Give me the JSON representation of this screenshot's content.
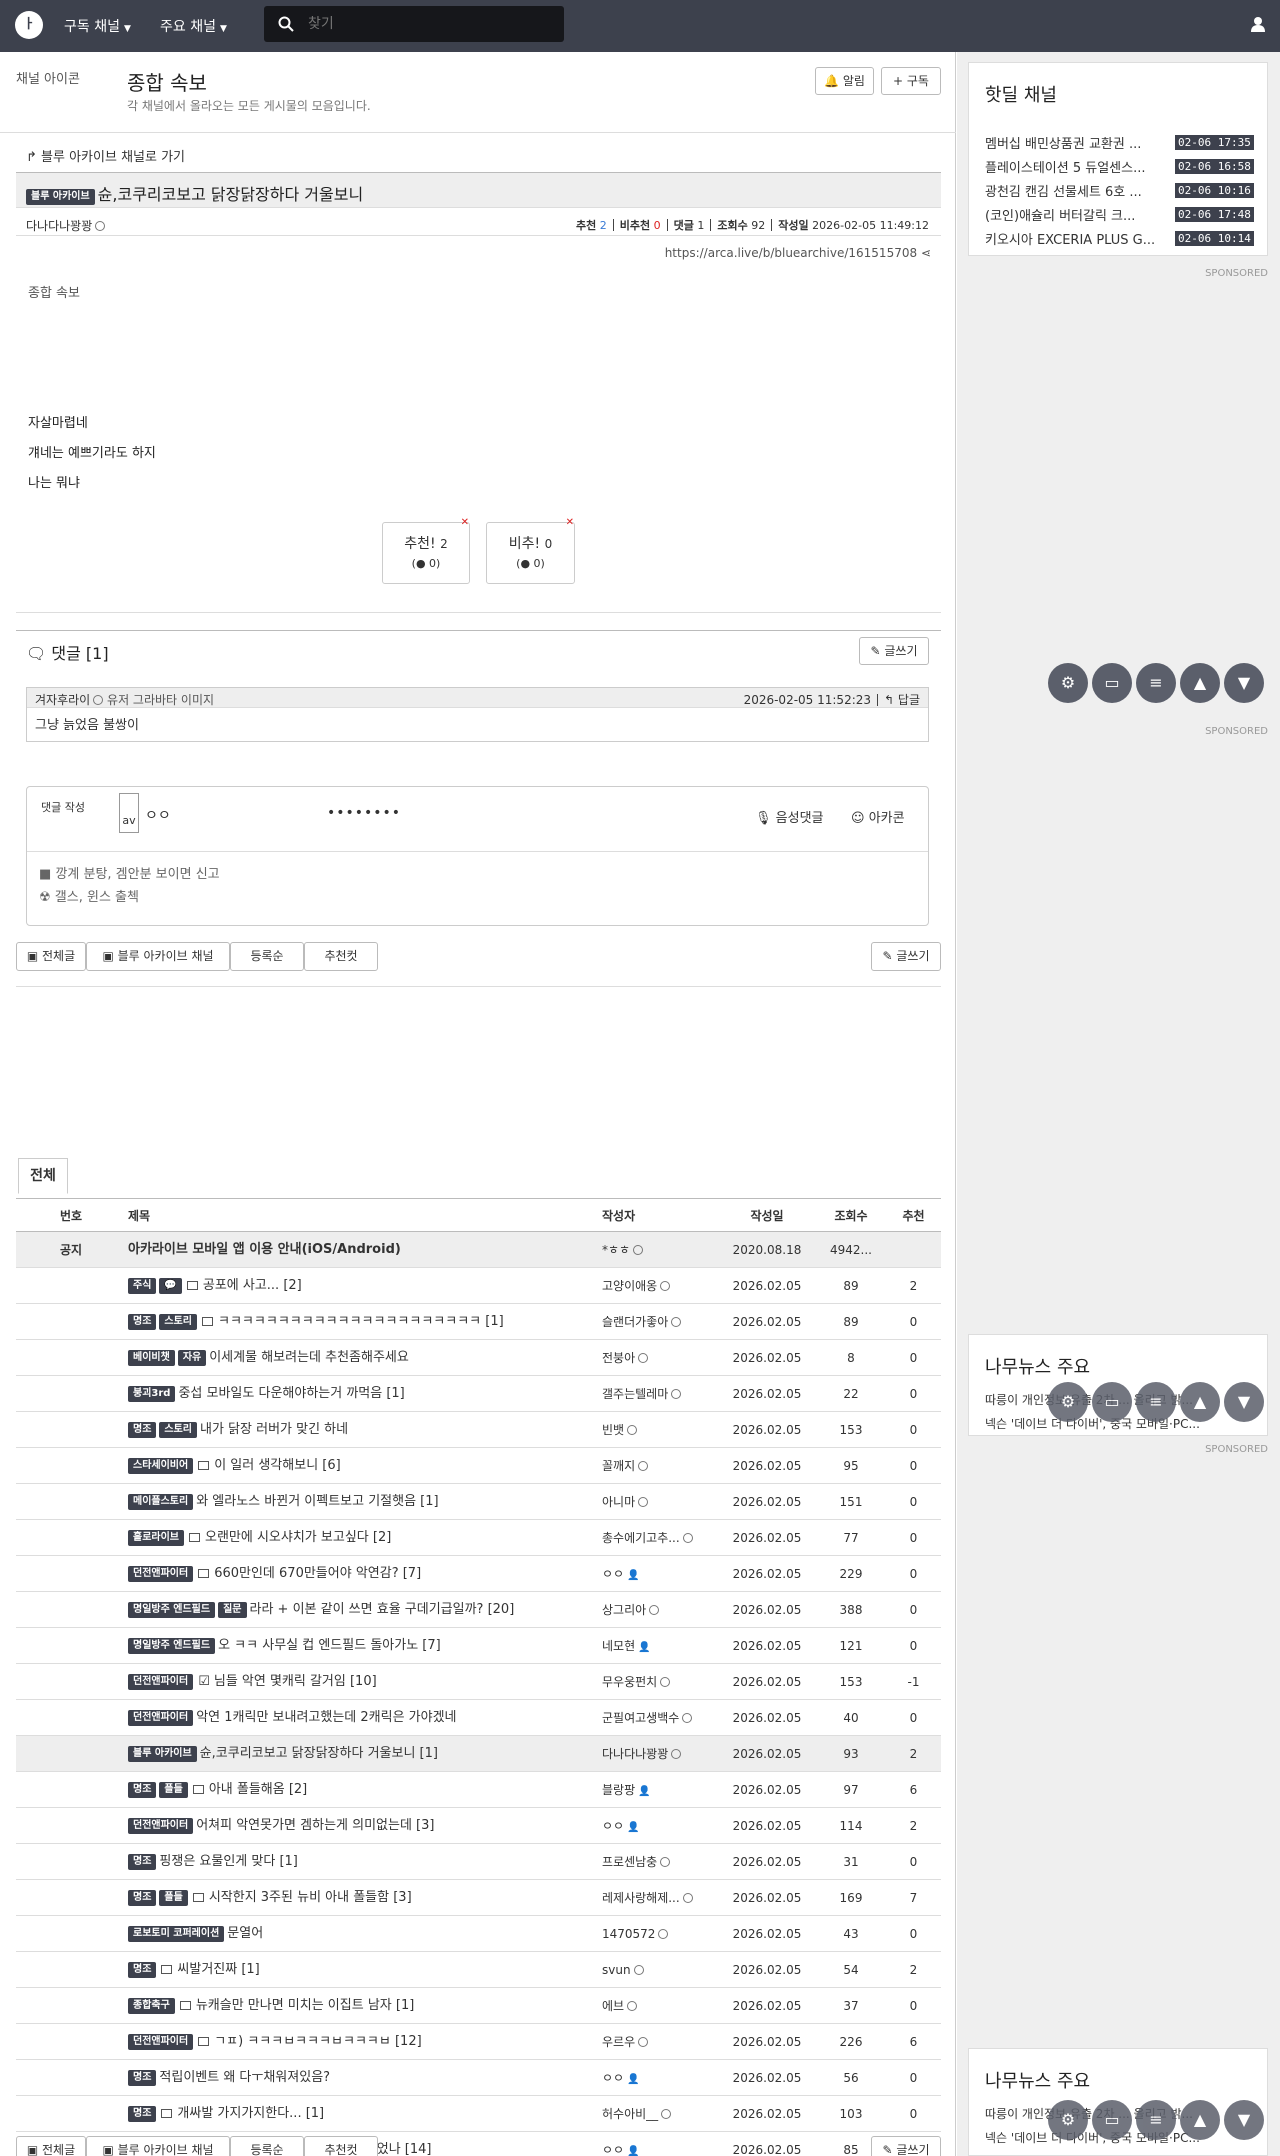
{
  "topbar": {
    "logo": "arca-logo-icon",
    "nav_subscribed": "구독 채널",
    "nav_major": "주요 채널",
    "search_placeholder": "찾기"
  },
  "channel": {
    "icon_alt": "채널 아이콘",
    "title": "종합 속보",
    "description": "각 채널에서 올라오는 모든 게시물의 모음입니다.",
    "alert_btn": "알림",
    "subscribe_btn": "구독"
  },
  "post": {
    "back_link": "블루 아카이브 채널로 가기",
    "category": "블루 아카이브",
    "title": "슌,코쿠리코보고 닭장닭장하다 거울보니",
    "author": "다나다나꽝꽝",
    "rec_label": "추천",
    "rec": "2",
    "unrec_label": "비추천",
    "unrec": "0",
    "comments_label": "댓글",
    "comments": "1",
    "views_label": "조회수",
    "views": "92",
    "date_label": "작성일",
    "date": "2026-02-05 11:49:12",
    "url": "https://arca.live/b/bluearchive/161515708",
    "image_alt": "종합 속보",
    "body_lines": [
      "자살마렵네",
      "걔네는 예쁘기라도 하지",
      "나는 뭐냐"
    ],
    "vote_up": "추천!",
    "vote_up_count": "2",
    "vote_up_sub": "0",
    "vote_down": "비추!",
    "vote_down_count": "0",
    "vote_down_sub": "0"
  },
  "comments": {
    "header": "댓글 [1]",
    "write_btn": "글쓰기",
    "items": [
      {
        "author": "겨자후라이",
        "avatar_alt": "유저 그라바타 이미지",
        "date": "2026-02-05 11:52:23",
        "reply": "답글",
        "text": "그냥 늙었음 불쌍이"
      }
    ],
    "form_label": "댓글 작성",
    "form_avatar": "av",
    "form_name": "ㅇㅇ",
    "form_password": "••••••••",
    "voice": "음성댓글",
    "arcacon": "아카콘",
    "notice_lines": [
      "깡계 분탕, 겜안분 보이면 신고",
      "갤스, 윈스 출첵"
    ]
  },
  "filterbar": {
    "all": "전체글",
    "channel": "블루 아카이브 채널",
    "order": "등록순",
    "best": "추천컷",
    "write": "글쓰기"
  },
  "table": {
    "tab": "전체",
    "headers": {
      "num": "번호",
      "title": "제목",
      "author": "작성자",
      "date": "작성일",
      "views": "조회수",
      "rec": "추천"
    },
    "notice": {
      "num": "공지",
      "title": "아카라이브 모바일 앱 이용 안내(iOS/Android)",
      "author": "*ㅎㅎ",
      "date": "2020.08.18",
      "views": "4942...",
      "rec": ""
    },
    "rows": [
      {
        "badges": [
          "주식",
          "💬"
        ],
        "icon": true,
        "check": false,
        "title": "공포에 사고... [2]",
        "author": "고양이애옹",
        "date": "2026.02.05",
        "views": "89",
        "rec": "2"
      },
      {
        "badges": [
          "명조",
          "스토리"
        ],
        "icon": true,
        "check": false,
        "title": "ㅋㅋㅋㅋㅋㅋㅋㅋㅋㅋㅋㅋㅋㅋㅋㅋㅋㅋㅋㅋㅋㅋ [1]",
        "author": "슬랜더가좋아",
        "date": "2026.02.05",
        "views": "89",
        "rec": "0"
      },
      {
        "badges": [
          "베이비챗",
          "자유"
        ],
        "icon": false,
        "check": false,
        "title": "이세계물 해보려는데 추천좀해주세요",
        "author": "전붕아",
        "date": "2026.02.05",
        "views": "8",
        "rec": "0"
      },
      {
        "badges": [
          "붕괴3rd"
        ],
        "icon": false,
        "check": false,
        "title": "중섭 모바일도 다운해야하는거 까먹음 [1]",
        "author": "갤주는텔레마",
        "date": "2026.02.05",
        "views": "22",
        "rec": "0"
      },
      {
        "badges": [
          "명조",
          "스토리"
        ],
        "icon": false,
        "check": false,
        "title": "내가 닭장 러버가 맞긴 하네",
        "author": "빈뱃",
        "date": "2026.02.05",
        "views": "153",
        "rec": "0"
      },
      {
        "badges": [
          "스타세이비어"
        ],
        "icon": true,
        "check": false,
        "title": "이 일러 생각해보니 [6]",
        "author": "꼴깨지",
        "date": "2026.02.05",
        "views": "95",
        "rec": "0"
      },
      {
        "badges": [
          "메이플스토리"
        ],
        "icon": false,
        "check": false,
        "title": "와 엘라노스 바뀐거 이펙트보고 기절햇음 [1]",
        "author": "아니마",
        "date": "2026.02.05",
        "views": "151",
        "rec": "0"
      },
      {
        "badges": [
          "홀로라이브"
        ],
        "icon": true,
        "check": false,
        "title": "오랜만에 시오샤치가 보고싶다 [2]",
        "author": "총수에기고추...",
        "date": "2026.02.05",
        "views": "77",
        "rec": "0"
      },
      {
        "badges": [
          "던전앤파이터"
        ],
        "icon": true,
        "check": false,
        "title": "660만인데 670만들어야 악연감? [7]",
        "author": "ㅇㅇ",
        "date": "2026.02.05",
        "views": "229",
        "rec": "0"
      },
      {
        "badges": [
          "명일방주 엔드필드",
          "질문"
        ],
        "icon": false,
        "check": false,
        "title": "라라 + 이본 같이 쓰면 효율 구데기급일까? [20]",
        "author": "상그리아",
        "date": "2026.02.05",
        "views": "388",
        "rec": "0"
      },
      {
        "badges": [
          "명일방주 엔드필드"
        ],
        "icon": false,
        "check": false,
        "title": "오 ㅋㅋ 사무실 컵 엔드필드 돌아가노 [7]",
        "author": "네모현",
        "date": "2026.02.05",
        "views": "121",
        "rec": "0"
      },
      {
        "badges": [
          "던전앤파이터"
        ],
        "icon": false,
        "check": true,
        "title": "님들 악연 몇캐릭 갈거임 [10]",
        "author": "무우웅펀치",
        "date": "2026.02.05",
        "views": "153",
        "rec": "-1"
      },
      {
        "badges": [
          "던전앤파이터"
        ],
        "icon": false,
        "check": false,
        "title": "악연 1캐릭만 보내려고했는데 2캐릭은 가야겠네",
        "author": "군필여고생백수",
        "date": "2026.02.05",
        "views": "40",
        "rec": "0"
      },
      {
        "badges": [
          "블루 아카이브"
        ],
        "icon": false,
        "check": false,
        "title": "슌,코쿠리코보고 닭장닭장하다 거울보니 [1]",
        "author": "다나다나꽝꽝",
        "date": "2026.02.05",
        "views": "93",
        "rec": "2",
        "hl": true
      },
      {
        "badges": [
          "명조",
          "플들"
        ],
        "icon": true,
        "check": false,
        "title": "아내 폴들해옴 [2]",
        "author": "블랑팡",
        "date": "2026.02.05",
        "views": "97",
        "rec": "6"
      },
      {
        "badges": [
          "던전앤파이터"
        ],
        "icon": false,
        "check": false,
        "title": "어쳐피 악연못가면 겜하는게 의미없는데 [3]",
        "author": "ㅇㅇ",
        "date": "2026.02.05",
        "views": "114",
        "rec": "2"
      },
      {
        "badges": [
          "명조"
        ],
        "icon": false,
        "check": false,
        "title": "핑쟁은 요물인게 맞다 [1]",
        "author": "프로센남충",
        "date": "2026.02.05",
        "views": "31",
        "rec": "0"
      },
      {
        "badges": [
          "명조",
          "플들"
        ],
        "icon": true,
        "check": false,
        "title": "시작한지 3주된 뉴비 아내 폴들함 [3]",
        "author": "레제사랑해제...",
        "date": "2026.02.05",
        "views": "169",
        "rec": "7"
      },
      {
        "badges": [
          "로보토미 코퍼레이션"
        ],
        "icon": false,
        "check": false,
        "title": "문열어",
        "author": "1470572",
        "date": "2026.02.05",
        "views": "43",
        "rec": "0"
      },
      {
        "badges": [
          "명조"
        ],
        "icon": true,
        "check": false,
        "title": "씨발거진짜 [1]",
        "author": "svun",
        "date": "2026.02.05",
        "views": "54",
        "rec": "2"
      },
      {
        "badges": [
          "종합축구"
        ],
        "icon": true,
        "check": false,
        "title": "뉴캐슬만 만나면 미치는 이집트 남자 [1]",
        "author": "에브",
        "date": "2026.02.05",
        "views": "37",
        "rec": "0"
      },
      {
        "badges": [
          "던전앤파이터"
        ],
        "icon": true,
        "check": false,
        "title": "ㄱㅍ) ㅋㅋㅋㅂㅋㅋㅋㅂㅋㅋㅋㅂ [12]",
        "author": "우르우",
        "date": "2026.02.05",
        "views": "226",
        "rec": "6"
      },
      {
        "badges": [
          "명조"
        ],
        "icon": false,
        "check": false,
        "title": "적립이벤트 왜 다ㅜ채워져있음?",
        "author": "ㅇㅇ",
        "date": "2026.02.05",
        "views": "56",
        "rec": "0"
      },
      {
        "badges": [
          "명조"
        ],
        "icon": true,
        "check": false,
        "title": "개싸발 가지가지한다... [1]",
        "author": "허수아비__",
        "date": "2026.02.05",
        "views": "103",
        "rec": "0"
      },
      {
        "badges": [
          "블루 아카이브"
        ],
        "icon": false,
        "check": false,
        "title": "싸이부거 세트가 7300원이나 했었나 [14]",
        "author": "ㅇㅇ",
        "date": "2026.02.05",
        "views": "85",
        "rec": "0"
      }
    ]
  },
  "sidebar": {
    "hotdeal_title": "핫딜 채널",
    "hotdeals": [
      {
        "title": "멤버십 배민상품권 교환권 ...",
        "time": "02-06 17:35"
      },
      {
        "title": "플레이스테이션 5 듀얼센스...",
        "time": "02-06 16:58"
      },
      {
        "title": "광천김 캔김 선물세트 6호 ...",
        "time": "02-06 10:16"
      },
      {
        "title": "(코인)애슐리 버터갈릭 크...",
        "time": "02-06 17:48"
      },
      {
        "title": "키오시아 EXCERIA PLUS G...",
        "time": "02-06 10:14"
      }
    ],
    "sponsored": "SPONSORED",
    "news_title": "나무뉴스 주요",
    "news_lines": [
      "따릉이 개인정보 유출 2차 ... 올리고 밝...",
      "넥슨 '데이브 더 다이버', 중국 모바일·PC..."
    ]
  }
}
